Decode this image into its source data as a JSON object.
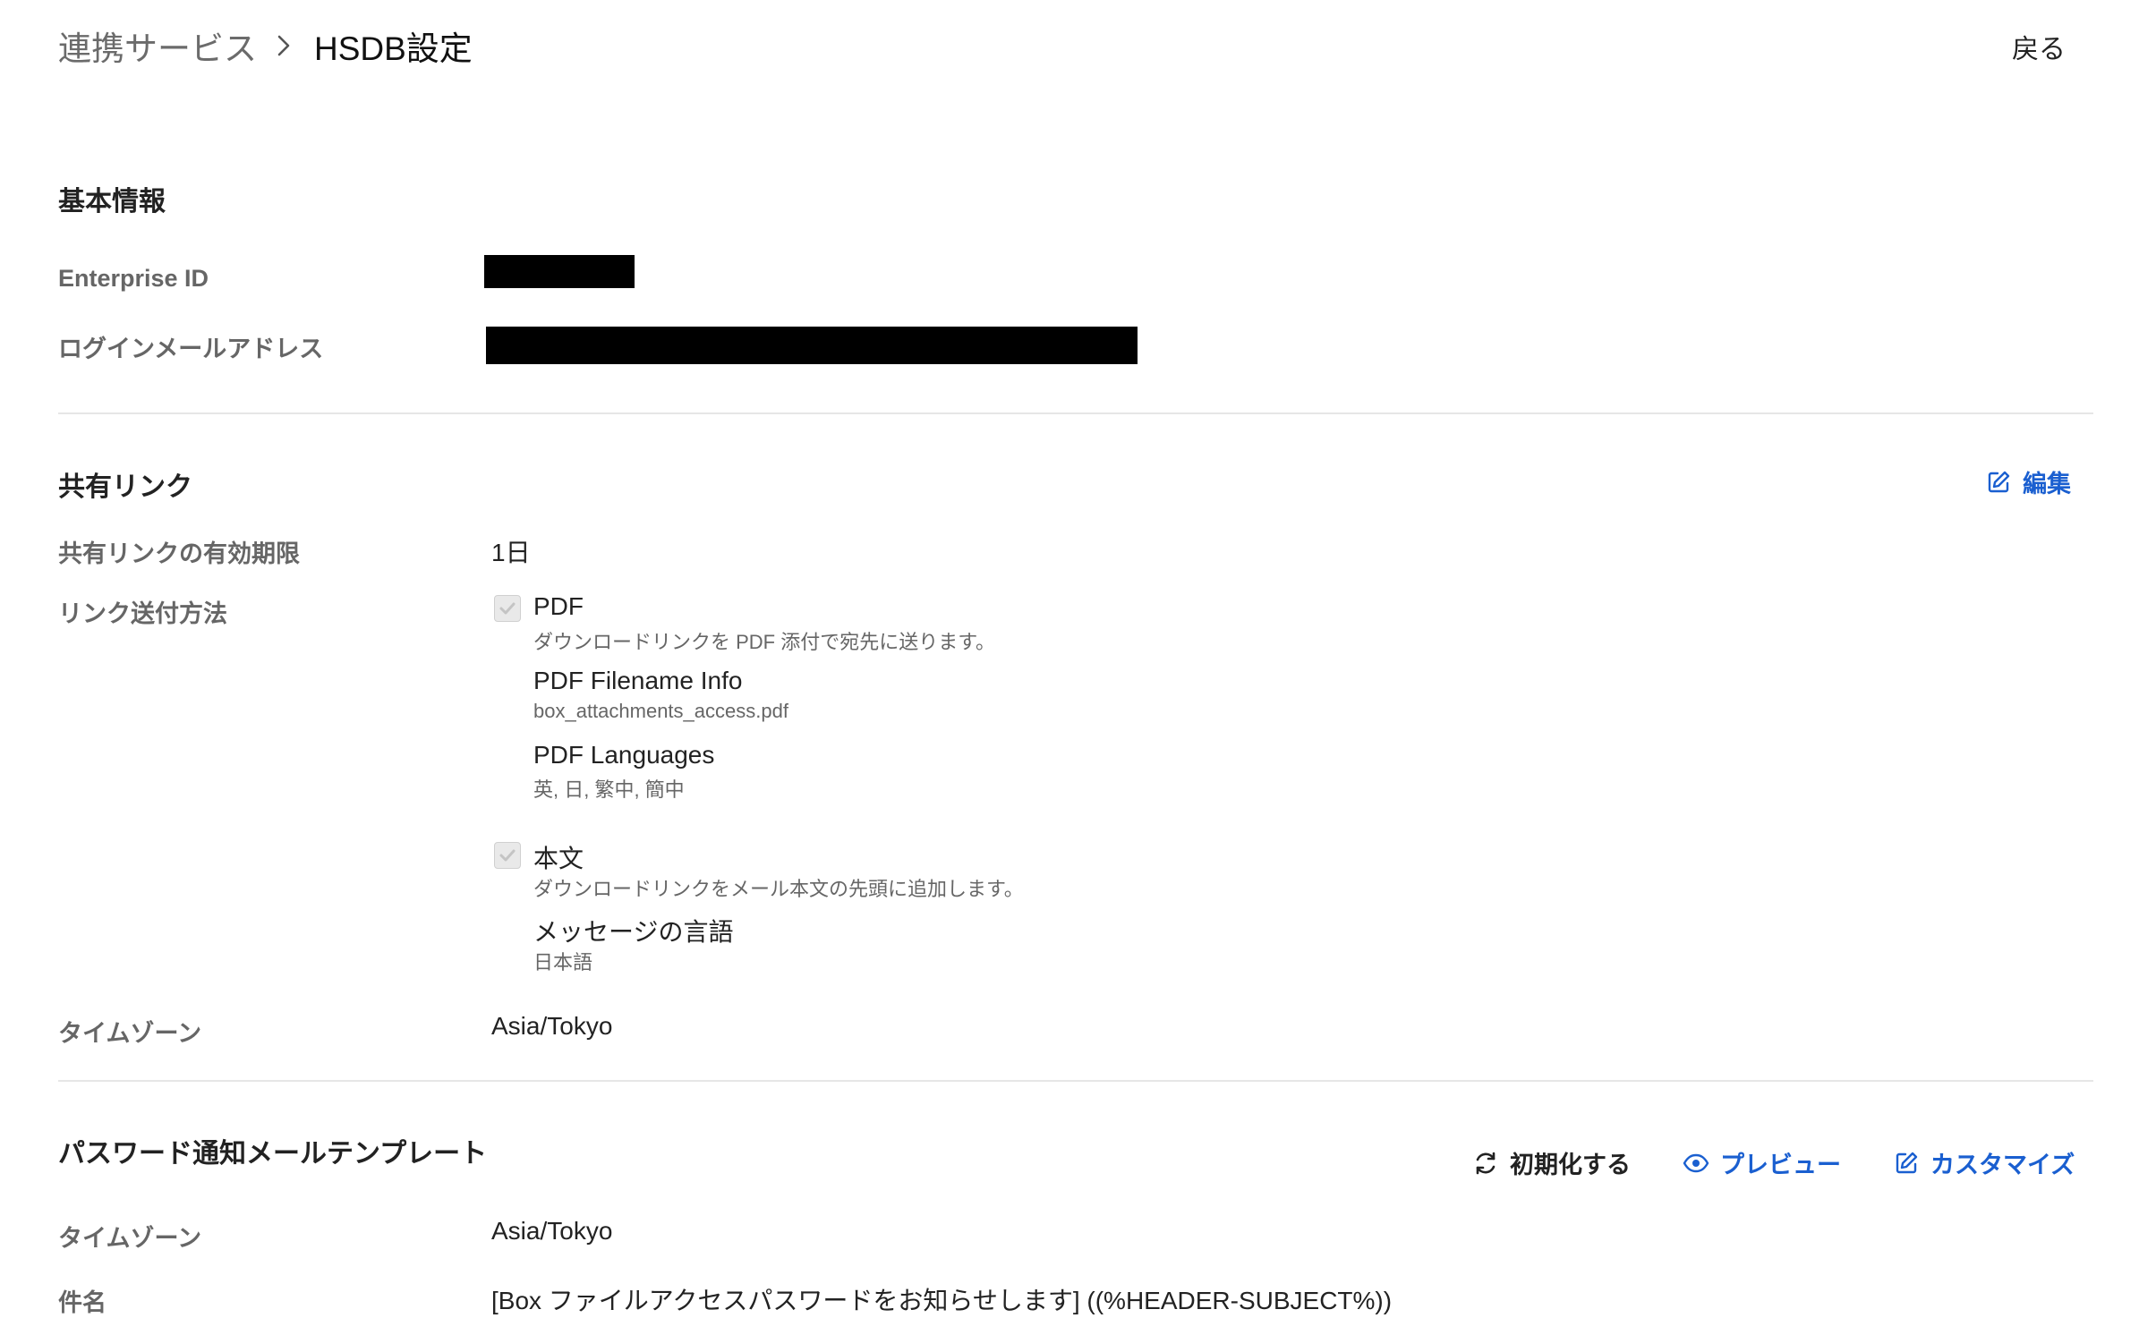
{
  "header": {
    "breadcrumb_parent": "連携サービス",
    "breadcrumb_current": "HSDB設定",
    "back_label": "戻る"
  },
  "basic_info": {
    "title": "基本情報",
    "enterprise_id_label": "Enterprise ID",
    "login_email_label": "ログインメールアドレス"
  },
  "shared_link": {
    "title": "共有リンク",
    "edit_label": "編集",
    "expiry_label": "共有リンクの有効期限",
    "expiry_value": "1日",
    "send_method_label": "リンク送付方法",
    "pdf": {
      "title": "PDF",
      "desc": "ダウンロードリンクを PDF 添付で宛先に送ります。",
      "filename_title": "PDF Filename Info",
      "filename_value": "box_attachments_access.pdf",
      "languages_title": "PDF Languages",
      "languages_value": "英, 日, 繁中, 簡中"
    },
    "body": {
      "title": "本文",
      "desc": "ダウンロードリンクをメール本文の先頭に追加します。",
      "message_lang_title": "メッセージの言語",
      "message_lang_value": "日本語"
    },
    "timezone_label": "タイムゾーン",
    "timezone_value": "Asia/Tokyo"
  },
  "password_template": {
    "title": "パスワード通知メールテンプレート",
    "reset_label": "初期化する",
    "preview_label": "プレビュー",
    "customize_label": "カスタマイズ",
    "timezone_label": "タイムゾーン",
    "timezone_value": "Asia/Tokyo",
    "subject_label": "件名",
    "subject_value": "[Box ファイルアクセスパスワードをお知らせします] ((%HEADER-SUBJECT%))"
  },
  "colors": {
    "accent_blue": "#1a5fd0",
    "label_gray": "#666666",
    "divider": "#e6e6e6"
  }
}
